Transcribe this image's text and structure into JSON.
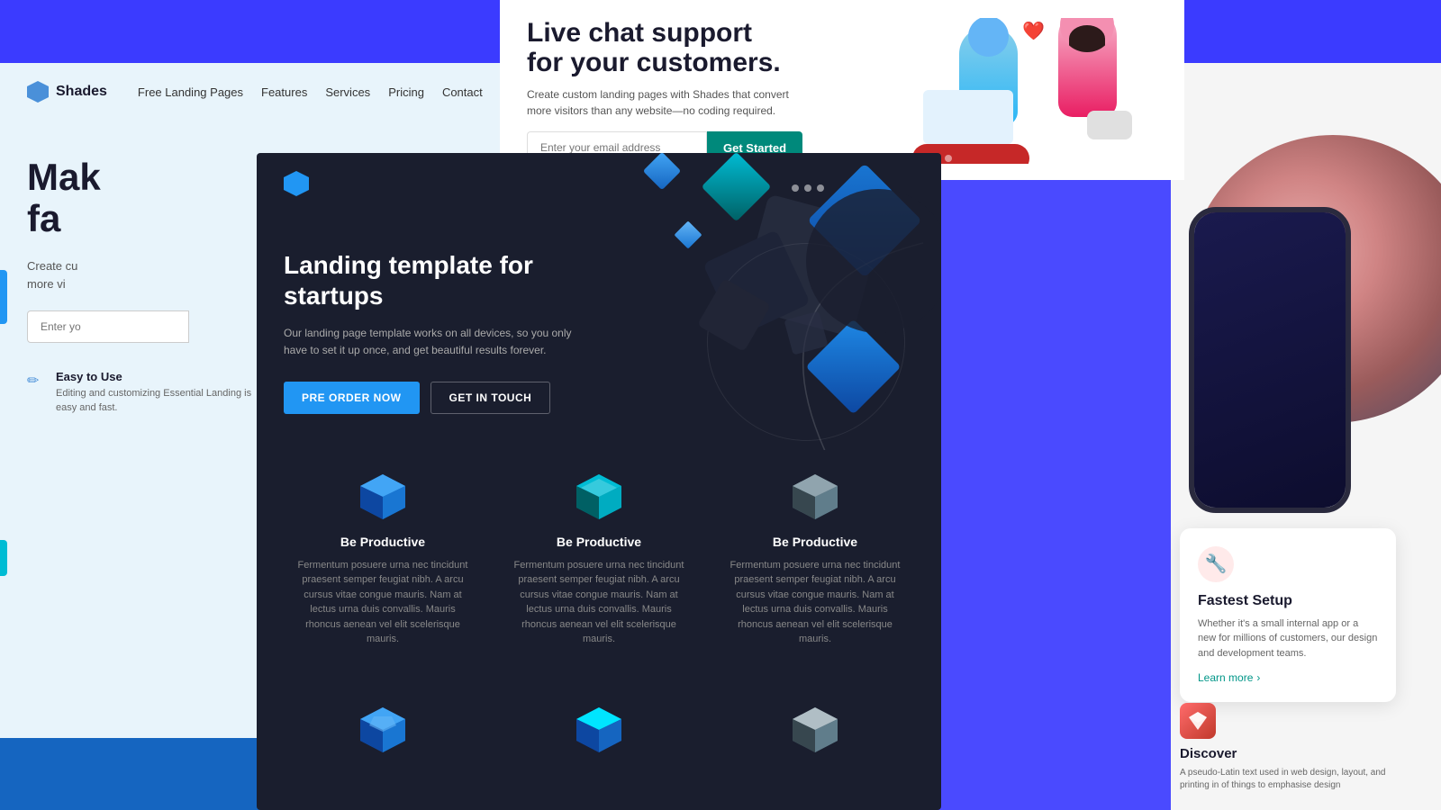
{
  "bg": {
    "color": "#4a4aff"
  },
  "panelLeft": {
    "nav": {
      "logo": "Shades",
      "links": [
        "Free Landing Pages",
        "Features",
        "Services",
        "Pricing",
        "Contact"
      ]
    },
    "title": "Mak\nfa",
    "subtitle": "Create cu\nmore vi",
    "inputPlaceholder": "Enter yo",
    "feature1": {
      "icon": "✏",
      "title": "Easy to Use",
      "desc": "Editing and customizing Essential Landing is easy and fast."
    }
  },
  "panelTopCenter": {
    "title": "Live chat support\nfor your customers.",
    "subtitle": "Create custom landing pages with Shades that convert\nmore visitors than any website—no coding required.",
    "inputPlaceholder": "Enter your email address",
    "buttonLabel": "Get Started"
  },
  "panelCenter": {
    "heading": "Landing template for\nstartups",
    "desc": "Our landing page template works on all devices, so you only have to set it up once, and get beautiful results forever.",
    "btn1": "PRE ORDER NOW",
    "btn2": "GET IN TOUCH",
    "features": [
      {
        "title": "Be Productive",
        "desc": "Fermentum posuere urna nec tincidunt praesent semper feugiat nibh. A arcu cursus vitae congue mauris. Nam at lectus urna duis convallis. Mauris rhoncus aenean vel elit scelerisque mauris.",
        "iconColor": "#2196f3"
      },
      {
        "title": "Be Productive",
        "desc": "Fermentum posuere urna nec tincidunt praesent semper feugiat nibh. A arcu cursus vitae congue mauris. Nam at lectus urna duis convallis. Mauris rhoncus aenean vel elit scelerisque mauris.",
        "iconColor": "#00bcd4"
      },
      {
        "title": "Be Productive",
        "desc": "Fermentum posuere urna nec tincidunt praesent semper feugiat nibh. A arcu cursus vitae congue mauris. Nam at lectus urna duis convallis. Mauris rhoncus aenean vel elit scelerisque mauris.",
        "iconColor": "#607d8b"
      }
    ],
    "features2": [
      {
        "iconColor": "#2196f3"
      },
      {
        "iconColor": "#00e5ff"
      },
      {
        "iconColor": "#607d8b"
      }
    ]
  },
  "panelRight": {
    "card": {
      "icon": "🔧",
      "title": "Fastest Setup",
      "desc": "Whether it's a small internal app or a new for millions of customers, our design and development teams.",
      "linkText": "Learn more"
    },
    "discover": {
      "title": "Discover",
      "desc": "A pseudo-Latin text used in web design, layout, and printing in of things to emphasise design"
    }
  }
}
